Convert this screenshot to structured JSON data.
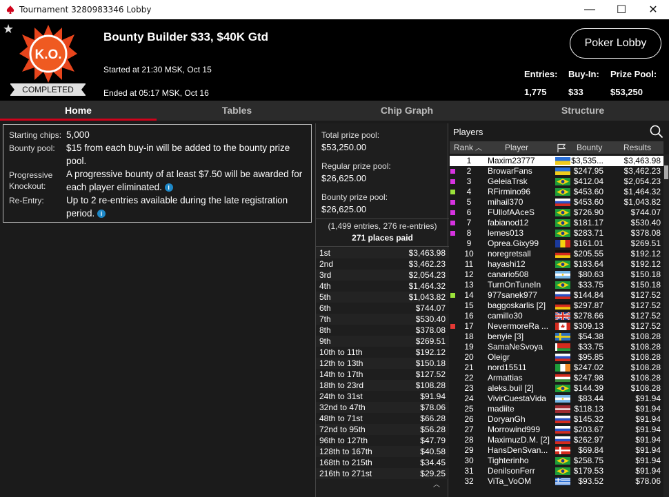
{
  "window": {
    "title": "Tournament 3280983346 Lobby",
    "minimize": "—",
    "maximize": "☐",
    "close": "✕"
  },
  "header": {
    "tournament_name": "Bounty Builder $33, $40K Gtd",
    "started": "Started at 21:30 MSK, Oct 15",
    "ended": "Ended at 05:17 MSK, Oct 16",
    "status": "COMPLETED",
    "logo_text": "K.O.",
    "lobby_button": "Poker Lobby",
    "entries_label": "Entries:",
    "entries_value": "1,775",
    "buyin_label": "Buy-In:",
    "buyin_value": "$33",
    "prizepool_label": "Prize Pool:",
    "prizepool_value": "$53,250"
  },
  "tabs": [
    "Home",
    "Tables",
    "Chip Graph",
    "Structure"
  ],
  "info": {
    "starting_chips_label": "Starting chips:",
    "starting_chips": "5,000",
    "bounty_pool_label": "Bounty pool:",
    "bounty_pool": "$15 from each buy-in will be added to the bounty prize pool.",
    "pko_label": "Progressive Knockout:",
    "pko": "A progressive bounty of at least $7.50 will be awarded for each player eliminated.",
    "reentry_label": "Re-Entry:",
    "reentry": "Up to 2 re-entries available during the late registration period."
  },
  "prize": {
    "total_label": "Total prize pool:",
    "total": "$53,250.00",
    "regular_label": "Regular prize pool:",
    "regular": "$26,625.00",
    "bounty_label": "Bounty prize pool:",
    "bounty": "$26,625.00",
    "entries_note": "(1,499 entries, 276 re-entries)",
    "places_paid": "271 places paid",
    "payouts": [
      {
        "place": "1st",
        "amount": "$3,463.98"
      },
      {
        "place": "2nd",
        "amount": "$3,462.23"
      },
      {
        "place": "3rd",
        "amount": "$2,054.23"
      },
      {
        "place": "4th",
        "amount": "$1,464.32"
      },
      {
        "place": "5th",
        "amount": "$1,043.82"
      },
      {
        "place": "6th",
        "amount": "$744.07"
      },
      {
        "place": "7th",
        "amount": "$530.40"
      },
      {
        "place": "8th",
        "amount": "$378.08"
      },
      {
        "place": "9th",
        "amount": "$269.51"
      },
      {
        "place": "10th to 11th",
        "amount": "$192.12"
      },
      {
        "place": "12th to 13th",
        "amount": "$150.18"
      },
      {
        "place": "14th to 17th",
        "amount": "$127.52"
      },
      {
        "place": "18th to 23rd",
        "amount": "$108.28"
      },
      {
        "place": "24th to 31st",
        "amount": "$91.94"
      },
      {
        "place": "32nd to 47th",
        "amount": "$78.06"
      },
      {
        "place": "48th to 71st",
        "amount": "$66.28"
      },
      {
        "place": "72nd to 95th",
        "amount": "$56.28"
      },
      {
        "place": "96th to 127th",
        "amount": "$47.79"
      },
      {
        "place": "128th to 167th",
        "amount": "$40.58"
      },
      {
        "place": "168th to 215th",
        "amount": "$34.45"
      },
      {
        "place": "216th to 271st",
        "amount": "$29.25"
      }
    ]
  },
  "players": {
    "title": "Players",
    "columns": {
      "rank": "Rank",
      "player": "Player",
      "bounty": "Bounty",
      "results": "Results"
    },
    "rows": [
      {
        "rank": "1",
        "name": "Maxim23777",
        "bounty": "$3,535...",
        "result": "$3,463.98",
        "flag": "ua",
        "mark": ""
      },
      {
        "rank": "2",
        "name": "BrowarFans",
        "bounty": "$247.95",
        "result": "$3,462.23",
        "flag": "ua",
        "mark": "#d633e0"
      },
      {
        "rank": "3",
        "name": "GeleiaTrsk",
        "bounty": "$412.04",
        "result": "$2,054.23",
        "flag": "br",
        "mark": "#d633e0"
      },
      {
        "rank": "4",
        "name": "RFirmino96",
        "bounty": "$453.60",
        "result": "$1,464.32",
        "flag": "br",
        "mark": "#9be33a"
      },
      {
        "rank": "5",
        "name": "mihail370",
        "bounty": "$453.60",
        "result": "$1,043.82",
        "flag": "ru",
        "mark": "#d633e0"
      },
      {
        "rank": "6",
        "name": "FUllofAAceS",
        "bounty": "$726.90",
        "result": "$744.07",
        "flag": "br",
        "mark": "#d633e0"
      },
      {
        "rank": "7",
        "name": "fabianod12",
        "bounty": "$181.17",
        "result": "$530.40",
        "flag": "br",
        "mark": "#d633e0"
      },
      {
        "rank": "8",
        "name": "lemes013",
        "bounty": "$283.71",
        "result": "$378.08",
        "flag": "br",
        "mark": "#d633e0"
      },
      {
        "rank": "9",
        "name": "Oprea.Gixy99",
        "bounty": "$161.01",
        "result": "$269.51",
        "flag": "ro",
        "mark": ""
      },
      {
        "rank": "10",
        "name": "noregretsall",
        "bounty": "$205.55",
        "result": "$192.12",
        "flag": "de",
        "mark": ""
      },
      {
        "rank": "11",
        "name": "hayashi12",
        "bounty": "$183.64",
        "result": "$192.12",
        "flag": "br",
        "mark": ""
      },
      {
        "rank": "12",
        "name": "canario508",
        "bounty": "$80.63",
        "result": "$150.18",
        "flag": "ar",
        "mark": ""
      },
      {
        "rank": "13",
        "name": "TurnOnTuneIn",
        "bounty": "$33.75",
        "result": "$150.18",
        "flag": "br",
        "mark": ""
      },
      {
        "rank": "14",
        "name": "977sanek977",
        "bounty": "$144.84",
        "result": "$127.52",
        "flag": "ru",
        "mark": "#9be33a"
      },
      {
        "rank": "15",
        "name": "baggoskarlis [2]",
        "bounty": "$297.87",
        "result": "$127.52",
        "flag": "de",
        "mark": ""
      },
      {
        "rank": "16",
        "name": "camillo30",
        "bounty": "$278.66",
        "result": "$127.52",
        "flag": "gb",
        "mark": ""
      },
      {
        "rank": "17",
        "name": "NevermoreRa ...",
        "bounty": "$309.13",
        "result": "$127.52",
        "flag": "ca",
        "mark": "#e53935"
      },
      {
        "rank": "18",
        "name": "benyie [3]",
        "bounty": "$54.38",
        "result": "$108.28",
        "flag": "se",
        "mark": ""
      },
      {
        "rank": "19",
        "name": "SamaNeSvoya",
        "bounty": "$33.75",
        "result": "$108.28",
        "flag": "by",
        "mark": ""
      },
      {
        "rank": "20",
        "name": "Oleigr",
        "bounty": "$95.85",
        "result": "$108.28",
        "flag": "ru",
        "mark": ""
      },
      {
        "rank": "21",
        "name": "nord15511",
        "bounty": "$247.02",
        "result": "$108.28",
        "flag": "ie",
        "mark": ""
      },
      {
        "rank": "22",
        "name": "Armattias",
        "bounty": "$247.98",
        "result": "$108.28",
        "flag": "hu",
        "mark": ""
      },
      {
        "rank": "23",
        "name": "aleks.buil [2]",
        "bounty": "$144.39",
        "result": "$108.28",
        "flag": "br",
        "mark": ""
      },
      {
        "rank": "24",
        "name": "VivirCuestaVida",
        "bounty": "$83.44",
        "result": "$91.94",
        "flag": "ar",
        "mark": ""
      },
      {
        "rank": "25",
        "name": "madiite",
        "bounty": "$118.13",
        "result": "$91.94",
        "flag": "lv",
        "mark": ""
      },
      {
        "rank": "26",
        "name": "DoryanGh",
        "bounty": "$145.32",
        "result": "$91.94",
        "flag": "ru",
        "mark": ""
      },
      {
        "rank": "27",
        "name": "Morrowind999",
        "bounty": "$203.67",
        "result": "$91.94",
        "flag": "ru",
        "mark": ""
      },
      {
        "rank": "28",
        "name": "MaximuzD.M. [2]",
        "bounty": "$262.97",
        "result": "$91.94",
        "flag": "ru",
        "mark": ""
      },
      {
        "rank": "29",
        "name": "HansDenSvan...",
        "bounty": "$69.84",
        "result": "$91.94",
        "flag": "dk",
        "mark": ""
      },
      {
        "rank": "30",
        "name": "Tighterinho",
        "bounty": "$258.75",
        "result": "$91.94",
        "flag": "br",
        "mark": ""
      },
      {
        "rank": "31",
        "name": "DenilsonFerr",
        "bounty": "$179.53",
        "result": "$91.94",
        "flag": "br",
        "mark": ""
      },
      {
        "rank": "32",
        "name": "ViTa_VoOM",
        "bounty": "$93.52",
        "result": "$78.06",
        "flag": "gr",
        "mark": ""
      }
    ]
  }
}
